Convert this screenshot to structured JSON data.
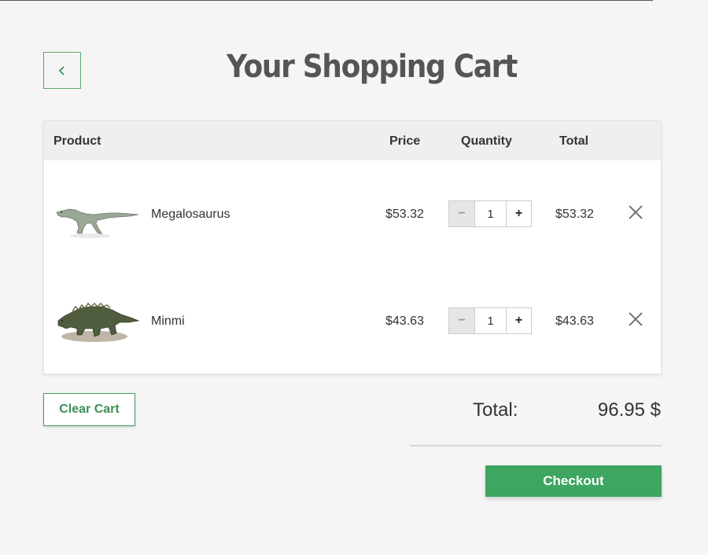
{
  "page": {
    "title": "Your Shopping Cart"
  },
  "table": {
    "headers": {
      "product": "Product",
      "price": "Price",
      "quantity": "Quantity",
      "total": "Total"
    },
    "items": [
      {
        "name": "Megalosaurus",
        "price": "$53.32",
        "quantity": "1",
        "total": "$53.32",
        "decrement_label": "−",
        "increment_label": "+"
      },
      {
        "name": "Minmi",
        "price": "$43.63",
        "quantity": "1",
        "total": "$43.63",
        "decrement_label": "−",
        "increment_label": "+"
      }
    ]
  },
  "actions": {
    "clear_cart_label": "Clear Cart",
    "checkout_label": "Checkout"
  },
  "summary": {
    "total_label": "Total:",
    "total_value": "96.95 $"
  },
  "colors": {
    "accent_green": "#3da660",
    "background": "#f5f5f5"
  },
  "icons": {
    "back": "chevron-left-icon",
    "remove": "close-icon"
  }
}
